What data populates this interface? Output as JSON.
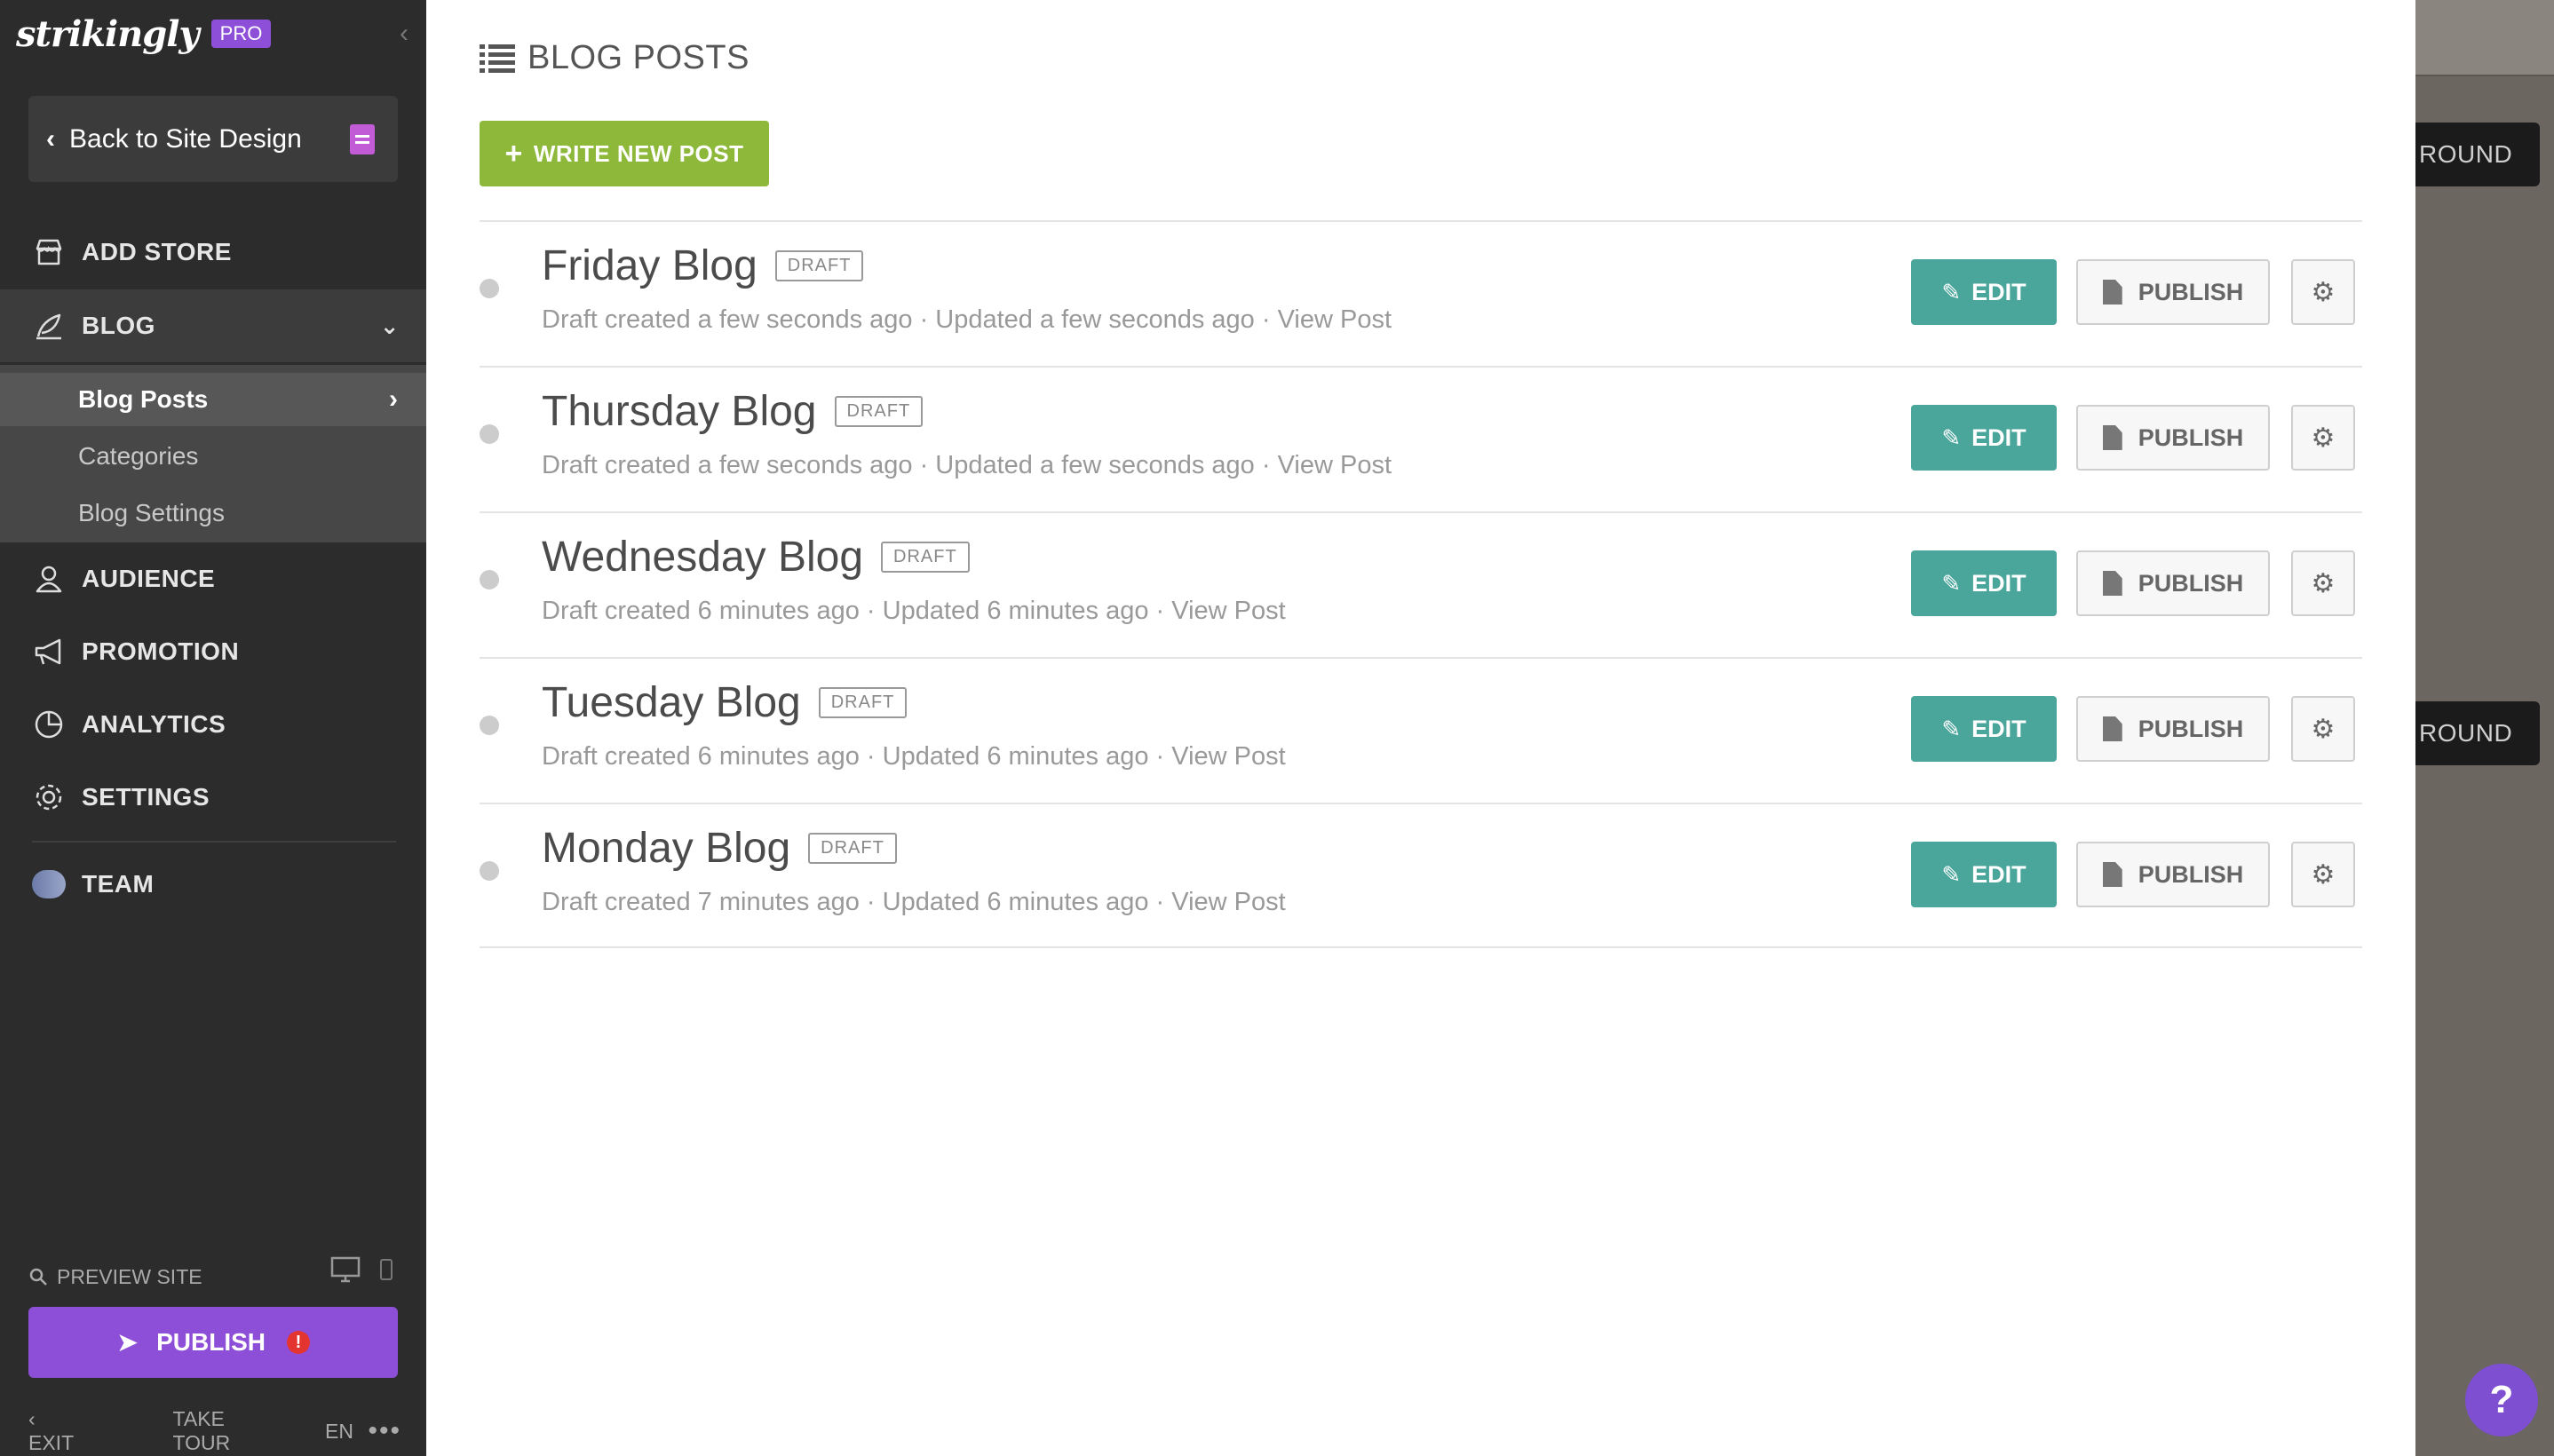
{
  "sidebar": {
    "brand": "strikingly",
    "plan_badge": "PRO",
    "back_label": "Back to Site Design",
    "nav": {
      "add_store": "ADD STORE",
      "blog": "BLOG",
      "audience": "AUDIENCE",
      "promotion": "PROMOTION",
      "analytics": "ANALYTICS",
      "settings": "SETTINGS",
      "team": "TEAM"
    },
    "blog_sub": {
      "posts": "Blog Posts",
      "categories": "Categories",
      "settings": "Blog Settings"
    },
    "preview_label": "PREVIEW SITE",
    "publish_label": "PUBLISH",
    "publish_alert": "!",
    "bottom": {
      "exit": "EXIT",
      "tour": "TAKE TOUR",
      "lang": "EN",
      "more": "•••"
    }
  },
  "main": {
    "heading": "BLOG POSTS",
    "write_label": "WRITE NEW POST",
    "posts": [
      {
        "title": "Friday Blog",
        "status": "DRAFT",
        "meta": "Draft created a few seconds ago · Updated a few seconds ago · ",
        "view": "View Post"
      },
      {
        "title": "Thursday Blog",
        "status": "DRAFT",
        "meta": "Draft created a few seconds ago · Updated a few seconds ago · ",
        "view": "View Post"
      },
      {
        "title": "Wednesday Blog",
        "status": "DRAFT",
        "meta": "Draft created 6 minutes ago · Updated 6 minutes ago · ",
        "view": "View Post"
      },
      {
        "title": "Tuesday Blog",
        "status": "DRAFT",
        "meta": "Draft created 6 minutes ago · Updated 6 minutes ago · ",
        "view": "View Post"
      },
      {
        "title": "Monday Blog",
        "status": "DRAFT",
        "meta": "Draft created 7 minutes ago · Updated 6 minutes ago · ",
        "view": "View Post"
      }
    ],
    "edit_label": "EDIT",
    "publish_label": "PUBLISH"
  },
  "background": {
    "button_text_1": "ROUND",
    "button_text_2": "ROUND"
  },
  "help_label": "?",
  "colors": {
    "sidebar": "#2c2c2c",
    "accent_purple": "#8e4fd8",
    "write_green": "#8db83a",
    "edit_teal": "#4aa59a"
  }
}
